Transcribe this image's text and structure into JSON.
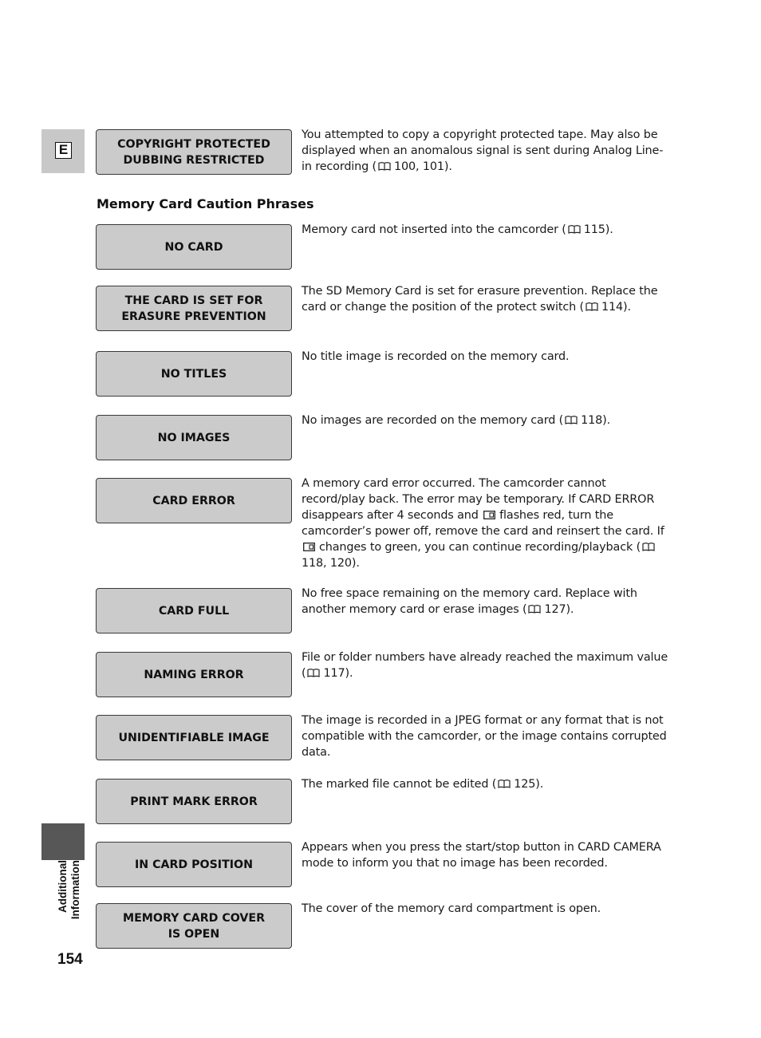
{
  "language_tab": {
    "letter": "E"
  },
  "sidebar": {
    "section_label_line1": "Additional",
    "section_label_line2": "Information"
  },
  "page_number": "154",
  "section_title": "Memory Card Caution Phrases",
  "intro_entry": {
    "phrase": "COPYRIGHT PROTECTED\nDUBBING RESTRICTED",
    "desc_before": "You attempted to copy a copyright protected tape. May also be displayed when an anomalous signal is sent during Analog Line-in recording (",
    "ref": "100, 101",
    "desc_after": ")."
  },
  "entries": [
    {
      "phrase": "NO CARD",
      "desc_before": "Memory card not inserted into the camcorder (",
      "ref": "115",
      "desc_after": ")."
    },
    {
      "phrase": "THE CARD IS SET FOR\nERASURE PREVENTION",
      "desc_before": "The SD Memory Card is set for erasure prevention. Replace the card or change the position of the protect switch (",
      "ref": "114",
      "desc_after": ")."
    },
    {
      "phrase": "NO TITLES",
      "desc_before": "No title image is recorded on the memory card.",
      "ref": null,
      "desc_after": ""
    },
    {
      "phrase": "NO IMAGES",
      "desc_before": "No images are recorded on the memory card (",
      "ref": "118",
      "desc_after": ")."
    },
    {
      "phrase": "CARD ERROR",
      "desc_part1": "A memory card error occurred. The camcorder cannot record/play back. The error may be temporary. If CARD ERROR disappears after 4 seconds and",
      "desc_part2": "flashes red, turn the camcorder’s power off, remove the card and reinsert the card. If",
      "desc_part3": "changes to green, you can continue recording/playback (",
      "ref": "118, 120",
      "desc_after": ")."
    },
    {
      "phrase": "CARD FULL",
      "desc_before": "No free space remaining on the memory card. Replace with another memory card or erase images (",
      "ref": "127",
      "desc_after": ")."
    },
    {
      "phrase": "NAMING ERROR",
      "desc_before": "File or folder numbers have already reached the maximum value (",
      "ref": "117",
      "desc_after": ")."
    },
    {
      "phrase": "UNIDENTIFIABLE IMAGE",
      "desc_before": "The image is recorded in a JPEG format or any format that is not compatible with the camcorder, or the image contains corrupted data.",
      "ref": null,
      "desc_after": ""
    },
    {
      "phrase": "PRINT MARK ERROR",
      "desc_before": "The marked file cannot be edited (",
      "ref": "125",
      "desc_after": ")."
    },
    {
      "phrase": "IN CARD POSITION",
      "desc_before": "Appears when you press the start/stop button in CARD CAMERA mode to inform you that no image has been recorded.",
      "ref": null,
      "desc_after": ""
    },
    {
      "phrase": "MEMORY CARD COVER\nIS OPEN",
      "desc_before": "The cover of the memory card compartment is open.",
      "ref": null,
      "desc_after": ""
    }
  ],
  "icons": {
    "reference": "book-reference-icon",
    "card": "memory-card-icon"
  }
}
